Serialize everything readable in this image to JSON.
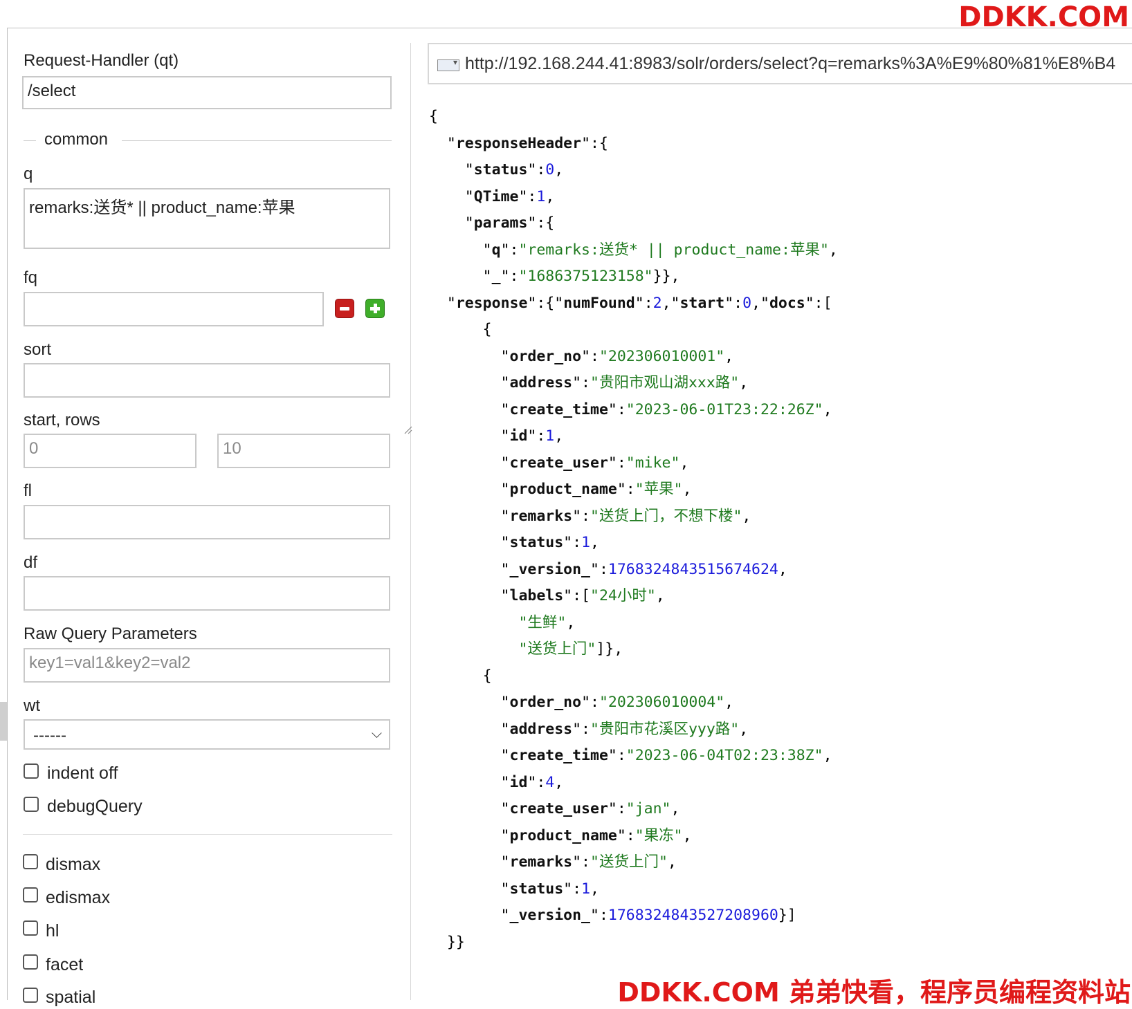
{
  "brand": {
    "top": "DDKK.COM",
    "bottom": "DDKK.COM 弟弟快看，程序员编程资料站"
  },
  "form": {
    "request_handler": {
      "label": "Request-Handler (qt)",
      "value": "/select"
    },
    "common_legend": "common",
    "q": {
      "label": "q",
      "value": "remarks:送货* || product_name:苹果"
    },
    "fq": {
      "label": "fq",
      "value": ""
    },
    "sort": {
      "label": "sort",
      "value": ""
    },
    "start_rows": {
      "label": "start, rows",
      "start": "0",
      "rows": "10"
    },
    "fl": {
      "label": "fl",
      "value": ""
    },
    "df": {
      "label": "df",
      "value": ""
    },
    "raw": {
      "label": "Raw Query Parameters",
      "placeholder": "key1=val1&key2=val2"
    },
    "wt": {
      "label": "wt",
      "selected": "------"
    },
    "checkboxes": [
      {
        "label": "indent off",
        "checked": false
      },
      {
        "label": "debugQuery",
        "checked": false
      },
      {
        "label": "dismax",
        "checked": false
      },
      {
        "label": "edismax",
        "checked": false
      },
      {
        "label": "hl",
        "checked": false
      },
      {
        "label": "facet",
        "checked": false
      },
      {
        "label": "spatial",
        "checked": false
      }
    ]
  },
  "url": "http://192.168.244.41:8983/solr/orders/select?q=remarks%3A%E9%80%81%E8%B4",
  "json_lines": [
    [
      [
        "p",
        "{"
      ]
    ],
    [
      [
        "p",
        "  \""
      ],
      [
        "k",
        "responseHeader"
      ],
      [
        "p",
        "\":{"
      ]
    ],
    [
      [
        "p",
        "    \""
      ],
      [
        "k",
        "status"
      ],
      [
        "p",
        "\":"
      ],
      [
        "n",
        "0"
      ],
      [
        "p",
        ","
      ]
    ],
    [
      [
        "p",
        "    \""
      ],
      [
        "k",
        "QTime"
      ],
      [
        "p",
        "\":"
      ],
      [
        "n",
        "1"
      ],
      [
        "p",
        ","
      ]
    ],
    [
      [
        "p",
        "    \""
      ],
      [
        "k",
        "params"
      ],
      [
        "p",
        "\":{"
      ]
    ],
    [
      [
        "p",
        "      \""
      ],
      [
        "k",
        "q"
      ],
      [
        "p",
        "\":"
      ],
      [
        "s",
        "\"remarks:送货* || product_name:苹果\""
      ],
      [
        "p",
        ","
      ]
    ],
    [
      [
        "p",
        "      \""
      ],
      [
        "k",
        "_"
      ],
      [
        "p",
        "\":"
      ],
      [
        "s",
        "\"1686375123158\""
      ],
      [
        "p",
        "}},"
      ]
    ],
    [
      [
        "p",
        "  \""
      ],
      [
        "k",
        "response"
      ],
      [
        "p",
        "\":{\""
      ],
      [
        "k",
        "numFound"
      ],
      [
        "p",
        "\":"
      ],
      [
        "n",
        "2"
      ],
      [
        "p",
        ",\""
      ],
      [
        "k",
        "start"
      ],
      [
        "p",
        "\":"
      ],
      [
        "n",
        "0"
      ],
      [
        "p",
        ",\""
      ],
      [
        "k",
        "docs"
      ],
      [
        "p",
        "\":["
      ]
    ],
    [
      [
        "p",
        "      {"
      ]
    ],
    [
      [
        "p",
        "        \""
      ],
      [
        "k",
        "order_no"
      ],
      [
        "p",
        "\":"
      ],
      [
        "s",
        "\"202306010001\""
      ],
      [
        "p",
        ","
      ]
    ],
    [
      [
        "p",
        "        \""
      ],
      [
        "k",
        "address"
      ],
      [
        "p",
        "\":"
      ],
      [
        "s",
        "\"贵阳市观山湖xxx路\""
      ],
      [
        "p",
        ","
      ]
    ],
    [
      [
        "p",
        "        \""
      ],
      [
        "k",
        "create_time"
      ],
      [
        "p",
        "\":"
      ],
      [
        "s",
        "\"2023-06-01T23:22:26Z\""
      ],
      [
        "p",
        ","
      ]
    ],
    [
      [
        "p",
        "        \""
      ],
      [
        "k",
        "id"
      ],
      [
        "p",
        "\":"
      ],
      [
        "n",
        "1"
      ],
      [
        "p",
        ","
      ]
    ],
    [
      [
        "p",
        "        \""
      ],
      [
        "k",
        "create_user"
      ],
      [
        "p",
        "\":"
      ],
      [
        "s",
        "\"mike\""
      ],
      [
        "p",
        ","
      ]
    ],
    [
      [
        "p",
        "        \""
      ],
      [
        "k",
        "product_name"
      ],
      [
        "p",
        "\":"
      ],
      [
        "s",
        "\"苹果\""
      ],
      [
        "p",
        ","
      ]
    ],
    [
      [
        "p",
        "        \""
      ],
      [
        "k",
        "remarks"
      ],
      [
        "p",
        "\":"
      ],
      [
        "s",
        "\"送货上门，不想下楼\""
      ],
      [
        "p",
        ","
      ]
    ],
    [
      [
        "p",
        "        \""
      ],
      [
        "k",
        "status"
      ],
      [
        "p",
        "\":"
      ],
      [
        "n",
        "1"
      ],
      [
        "p",
        ","
      ]
    ],
    [
      [
        "p",
        "        \""
      ],
      [
        "k",
        "_version_"
      ],
      [
        "p",
        "\":"
      ],
      [
        "n",
        "1768324843515674624"
      ],
      [
        "p",
        ","
      ]
    ],
    [
      [
        "p",
        "        \""
      ],
      [
        "k",
        "labels"
      ],
      [
        "p",
        "\":["
      ],
      [
        "s",
        "\"24小时\""
      ],
      [
        "p",
        ","
      ]
    ],
    [
      [
        "p",
        "          "
      ],
      [
        "s",
        "\"生鲜\""
      ],
      [
        "p",
        ","
      ]
    ],
    [
      [
        "p",
        "          "
      ],
      [
        "s",
        "\"送货上门\""
      ],
      [
        "p",
        "]},"
      ]
    ],
    [
      [
        "p",
        "      {"
      ]
    ],
    [
      [
        "p",
        "        \""
      ],
      [
        "k",
        "order_no"
      ],
      [
        "p",
        "\":"
      ],
      [
        "s",
        "\"202306010004\""
      ],
      [
        "p",
        ","
      ]
    ],
    [
      [
        "p",
        "        \""
      ],
      [
        "k",
        "address"
      ],
      [
        "p",
        "\":"
      ],
      [
        "s",
        "\"贵阳市花溪区yyy路\""
      ],
      [
        "p",
        ","
      ]
    ],
    [
      [
        "p",
        "        \""
      ],
      [
        "k",
        "create_time"
      ],
      [
        "p",
        "\":"
      ],
      [
        "s",
        "\"2023-06-04T02:23:38Z\""
      ],
      [
        "p",
        ","
      ]
    ],
    [
      [
        "p",
        "        \""
      ],
      [
        "k",
        "id"
      ],
      [
        "p",
        "\":"
      ],
      [
        "n",
        "4"
      ],
      [
        "p",
        ","
      ]
    ],
    [
      [
        "p",
        "        \""
      ],
      [
        "k",
        "create_user"
      ],
      [
        "p",
        "\":"
      ],
      [
        "s",
        "\"jan\""
      ],
      [
        "p",
        ","
      ]
    ],
    [
      [
        "p",
        "        \""
      ],
      [
        "k",
        "product_name"
      ],
      [
        "p",
        "\":"
      ],
      [
        "s",
        "\"果冻\""
      ],
      [
        "p",
        ","
      ]
    ],
    [
      [
        "p",
        "        \""
      ],
      [
        "k",
        "remarks"
      ],
      [
        "p",
        "\":"
      ],
      [
        "s",
        "\"送货上门\""
      ],
      [
        "p",
        ","
      ]
    ],
    [
      [
        "p",
        "        \""
      ],
      [
        "k",
        "status"
      ],
      [
        "p",
        "\":"
      ],
      [
        "n",
        "1"
      ],
      [
        "p",
        ","
      ]
    ],
    [
      [
        "p",
        "        \""
      ],
      [
        "k",
        "_version_"
      ],
      [
        "p",
        "\":"
      ],
      [
        "n",
        "1768324843527208960"
      ],
      [
        "p",
        "}]"
      ]
    ],
    [
      [
        "p",
        "  }}"
      ]
    ]
  ]
}
